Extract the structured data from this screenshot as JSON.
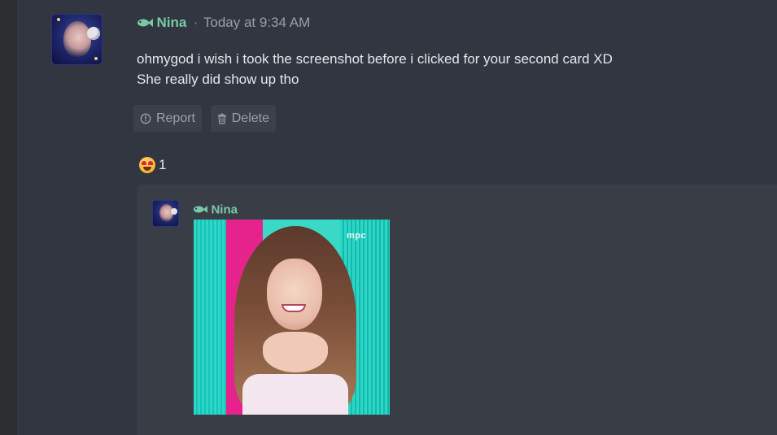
{
  "message": {
    "author": "Nina",
    "separator": "·",
    "timestamp": "Today at 9:34 AM",
    "lines": [
      "ohmygod i wish i took the screenshot before i clicked for your second card XD",
      "She really did show up tho"
    ],
    "actions": {
      "report_label": "Report",
      "delete_label": "Delete"
    },
    "reaction": {
      "emoji": "star-struck-emoji",
      "count": "1"
    }
  },
  "quote": {
    "author": "Nina",
    "image": {
      "watermark": "mpc"
    }
  },
  "colors": {
    "author_name": "#79c9a6",
    "background": "#323640",
    "card": "#393d46",
    "button": "#3c4049"
  }
}
